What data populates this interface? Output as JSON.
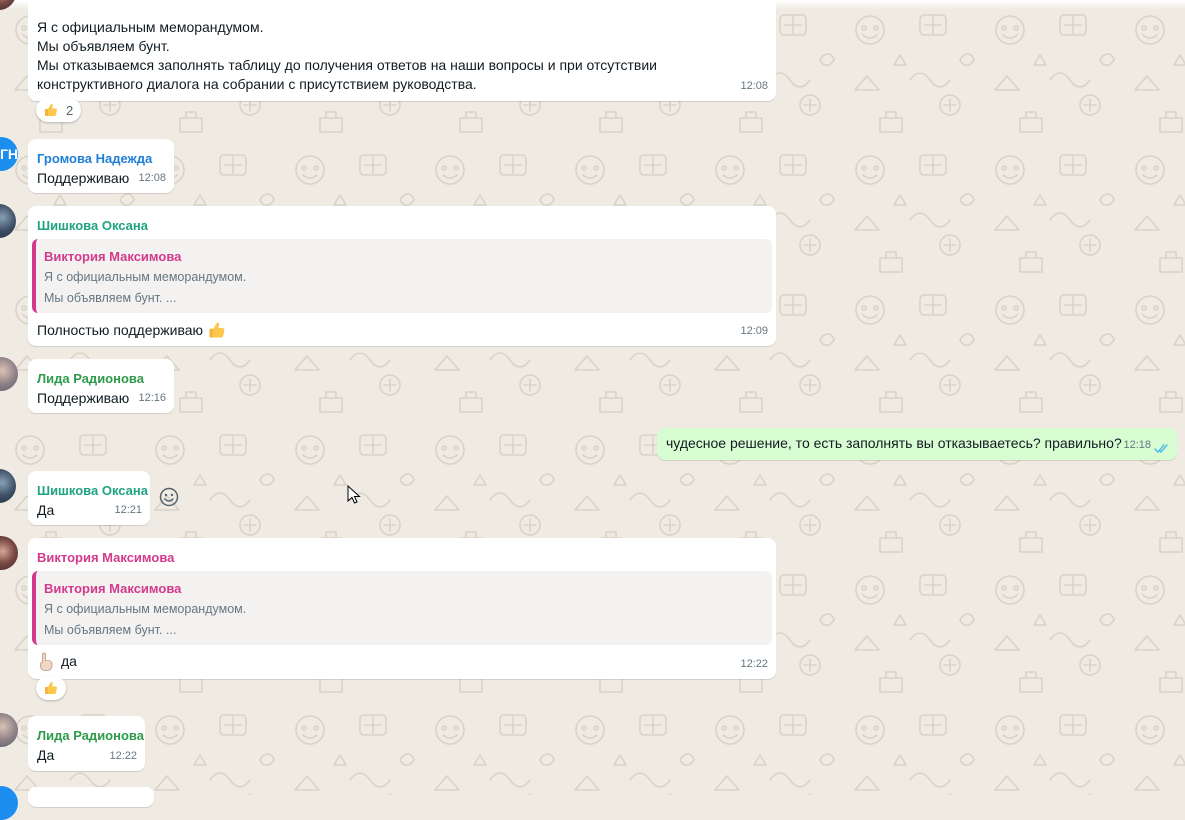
{
  "messages": {
    "m1": {
      "line1": "Я с официальным меморандумом.",
      "line2": "Мы объявляем бунт.",
      "line3": "Мы отказываемся заполнять таблицу до получения ответов на наши вопросы и при отсутствии",
      "line4": "конструктивного диалога на собрании с присутствием руководства.",
      "time": "12:08",
      "reaction_count": "2"
    },
    "m2": {
      "avatar_initials": "ГН",
      "sender": "Громова Надежда",
      "text": "Поддерживаю",
      "time": "12:08"
    },
    "m3": {
      "sender": "Шишкова Оксана",
      "quote_sender": "Виктория Максимова",
      "quote_line1": "Я с официальным меморандумом.",
      "quote_line2": "Мы объявляем бунт. ...",
      "text": "Полностью поддерживаю",
      "time": "12:09"
    },
    "m4": {
      "sender": "Лида Радионова",
      "text": "Поддерживаю",
      "time": "12:16"
    },
    "m5": {
      "text": "чудесное решение, то есть заполнять вы отказываетесь? правильно?",
      "time": "12:18"
    },
    "m6": {
      "sender": "Шишкова Оксана",
      "text": "Да",
      "time": "12:21"
    },
    "m7": {
      "sender": "Виктория Максимова",
      "quote_sender": "Виктория Максимова",
      "quote_line1": "Я с официальным меморандумом.",
      "quote_line2": "Мы объявляем бунт. ...",
      "text": "да",
      "time": "12:22"
    },
    "m8": {
      "sender": "Лида Радионова",
      "text": "Да",
      "time": "12:22"
    }
  },
  "colors": {
    "background": "#efeae2",
    "incoming_bubble": "#ffffff",
    "outgoing_bubble": "#d9fdd3",
    "read_check": "#53bdeb",
    "sender_blue": "#1f7ed6",
    "sender_teal": "#1fa381",
    "sender_green": "#2d9b4a",
    "sender_pink": "#d43a8c"
  },
  "icons": {
    "reaction": "thumbs-up-icon",
    "emoji": "smiley-icon",
    "read_status": "double-check-icon",
    "pointer": "hand-pointing-up-icon"
  }
}
